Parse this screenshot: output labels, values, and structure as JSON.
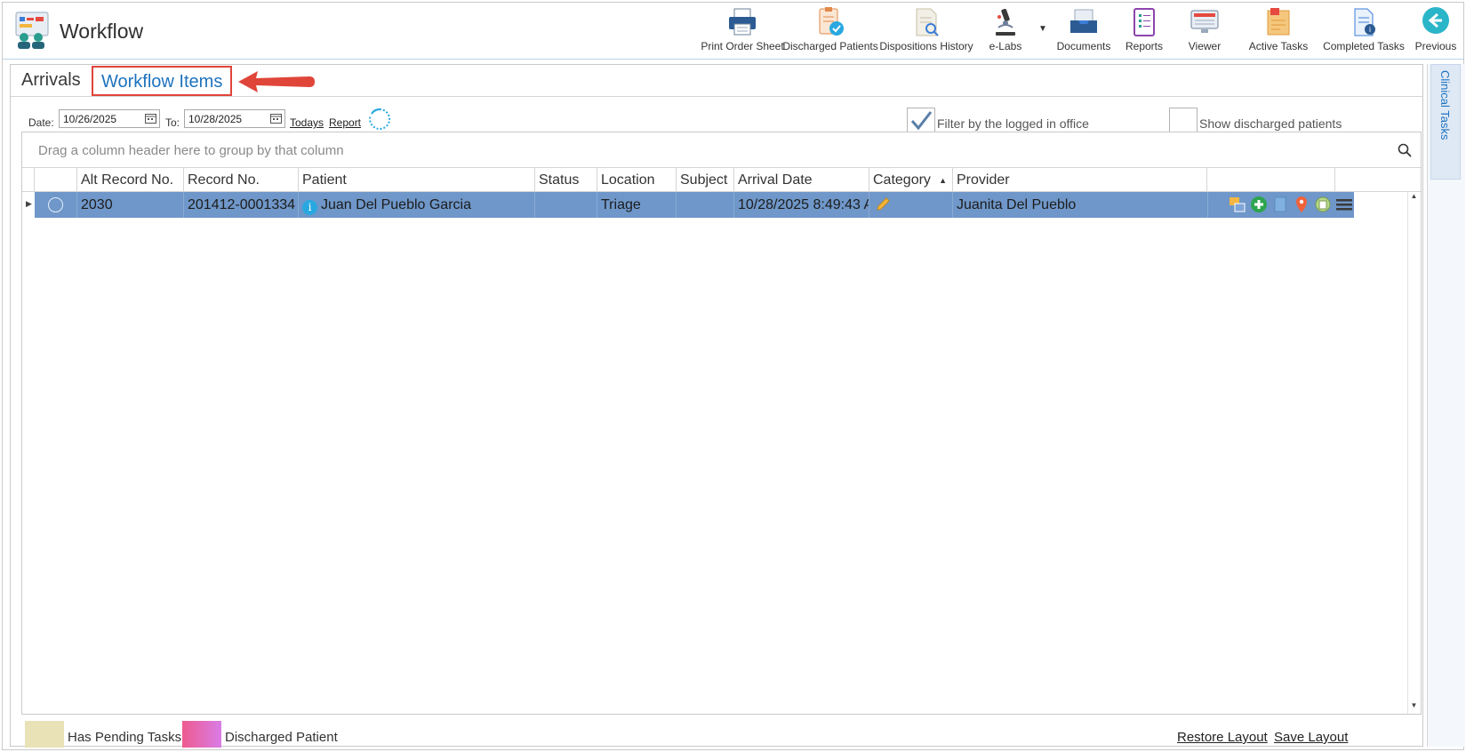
{
  "app": {
    "title": "Workflow"
  },
  "toolbar": [
    {
      "label": "Print Order Sheet",
      "icon": "printer-icon"
    },
    {
      "label": "Discharged Patients",
      "icon": "discharged-patients-icon"
    },
    {
      "label": "Dispositions History",
      "icon": "dispositions-history-icon"
    },
    {
      "label": "e-Labs",
      "icon": "microscope-icon",
      "has_dropdown": true
    },
    {
      "label": "Documents",
      "icon": "documents-tray-icon"
    },
    {
      "label": "Reports",
      "icon": "reports-icon"
    },
    {
      "label": "Viewer",
      "icon": "viewer-monitor-icon"
    },
    {
      "label": "Active Tasks",
      "icon": "active-tasks-icon"
    },
    {
      "label": "Completed Tasks",
      "icon": "completed-tasks-icon"
    },
    {
      "label": "Previous",
      "icon": "back-arrow-icon"
    }
  ],
  "tabs": {
    "arrivals": "Arrivals",
    "workflow_items": "Workflow Items"
  },
  "filters": {
    "date_label": "Date:",
    "date_from": "10/26/2025",
    "to_label": "To:",
    "date_to": "10/28/2025",
    "todays_link": "Todays",
    "report_link": "Report",
    "filter_office_label": "Filter by the logged in office",
    "filter_office_checked": true,
    "show_discharged_label": "Show discharged patients",
    "show_discharged_checked": false
  },
  "grid": {
    "group_hint": "Drag a column header here to group by that column",
    "columns": [
      "Alt Record No.",
      "Record No.",
      "Patient",
      "Status",
      "Location",
      "Subject",
      "Arrival Date",
      "Category",
      "Provider"
    ],
    "sorted_column": "Category",
    "rows": [
      {
        "alt_record_no": "2030",
        "record_no": "201412-0001334",
        "patient": "Juan Del Pueblo Garcia",
        "status": "",
        "location": "Triage",
        "subject": "",
        "arrival_date": "10/28/2025 8:49:43 A",
        "category": "",
        "provider": "Juanita Del Pueblo"
      }
    ]
  },
  "legend": [
    {
      "label": "Has Pending Tasks",
      "color": "#e8e2b6"
    },
    {
      "label": "Discharged Patient",
      "color": "#e24fa0"
    }
  ],
  "footer": {
    "restore_layout": "Restore Layout",
    "save_layout": "Save Layout"
  },
  "side_panel": {
    "clinical_tasks": "Clinical Tasks"
  },
  "colors": {
    "selected_row": "#6f97c9",
    "accent": "#1e73be",
    "highlight_box": "#e0453a"
  }
}
